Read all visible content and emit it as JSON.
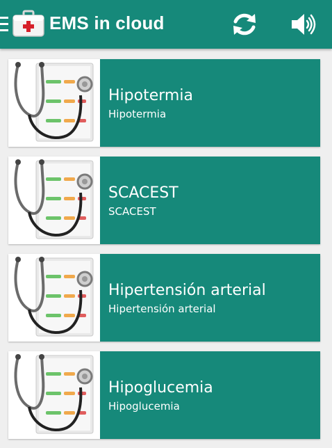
{
  "appbar": {
    "title": "EMS in cloud",
    "menu_icon": "hamburger-menu-icon",
    "logo_icon": "first-aid-kit-icon",
    "refresh_icon": "refresh-icon",
    "sound_icon": "speaker-volume-icon",
    "color": "#16897a"
  },
  "cards": [
    {
      "title": "Hipotermia",
      "subtitle": "Hipotermia",
      "thumbnail": "stethoscope-checklist-icon"
    },
    {
      "title": "SCACEST",
      "subtitle": "SCACEST",
      "thumbnail": "stethoscope-checklist-icon"
    },
    {
      "title": "Hipertensión arterial",
      "subtitle": "Hipertensión arterial",
      "thumbnail": "stethoscope-checklist-icon"
    },
    {
      "title": "Hipoglucemia",
      "subtitle": "Hipoglucemia",
      "thumbnail": "stethoscope-checklist-icon"
    }
  ],
  "colors": {
    "accent": "#16897a",
    "background": "#efefef",
    "text_on_accent": "#ffffff"
  }
}
